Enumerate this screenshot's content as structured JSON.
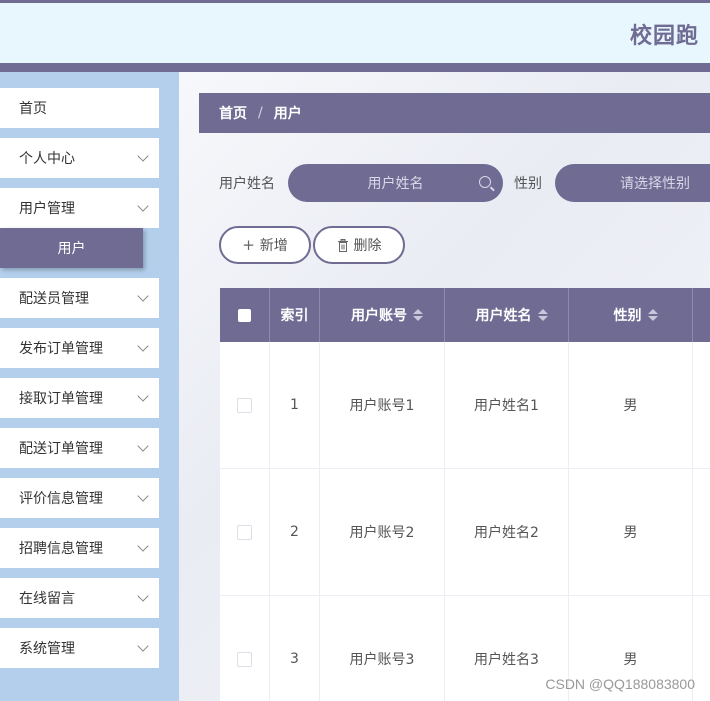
{
  "header": {
    "title": "校园跑"
  },
  "sidebar": {
    "items": [
      {
        "label": "首页"
      },
      {
        "label": "个人中心"
      },
      {
        "label": "用户管理",
        "submenu": [
          "用户"
        ]
      },
      {
        "label": "配送员管理"
      },
      {
        "label": "发布订单管理"
      },
      {
        "label": "接取订单管理"
      },
      {
        "label": "配送订单管理"
      },
      {
        "label": "评价信息管理"
      },
      {
        "label": "招聘信息管理"
      },
      {
        "label": "在线留言"
      },
      {
        "label": "系统管理"
      }
    ]
  },
  "breadcrumb": {
    "home": "首页",
    "sep": "/",
    "current": "用户"
  },
  "search": {
    "name_label": "用户姓名",
    "name_placeholder": "用户姓名",
    "gender_label": "性别",
    "gender_placeholder": "请选择性别"
  },
  "actions": {
    "add": "新增",
    "delete": "删除"
  },
  "table": {
    "columns": [
      "索引",
      "用户账号",
      "用户姓名",
      "性别"
    ],
    "rows": [
      {
        "index": "1",
        "account": "用户账号1",
        "name": "用户姓名1",
        "gender": "男"
      },
      {
        "index": "2",
        "account": "用户账号2",
        "name": "用户姓名2",
        "gender": "男"
      },
      {
        "index": "3",
        "account": "用户账号3",
        "name": "用户姓名3",
        "gender": "男"
      }
    ]
  },
  "watermark": "CSDN @QQ188083800",
  "colors": {
    "accent": "#6f6b93",
    "sidebar_bg": "#b3cfec",
    "header_bg": "#e8f6fd"
  }
}
